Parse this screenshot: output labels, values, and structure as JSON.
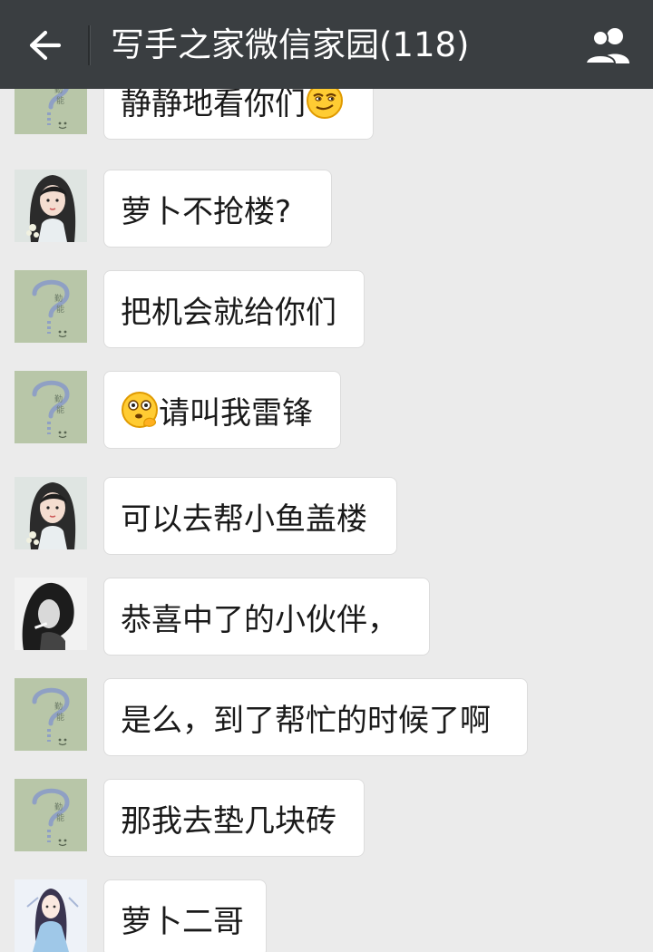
{
  "header": {
    "title": "写手之家微信家园(118)",
    "back_icon": "arrow-left-icon",
    "group_icon": "group-members-icon"
  },
  "colors": {
    "topbar": "#3a3e41",
    "background": "#ebebeb",
    "bubble": "#ffffff"
  },
  "messages": [
    {
      "avatar": "question-mark-avatar",
      "text": "静静地看你们",
      "emoji_after": "smirk-emoji"
    },
    {
      "avatar": "lady-portrait-avatar",
      "text": "萝卜不抢楼?"
    },
    {
      "avatar": "question-mark-avatar",
      "text": "把机会就给你们"
    },
    {
      "avatar": "question-mark-avatar",
      "text": "请叫我雷锋",
      "emoji_before": "thinking-emoji"
    },
    {
      "avatar": "lady-portrait-avatar",
      "text": "可以去帮小鱼盖楼"
    },
    {
      "avatar": "smoking-woman-avatar",
      "text": "恭喜中了的小伙伴，"
    },
    {
      "avatar": "question-mark-avatar",
      "text": "是么，到了帮忙的时候了啊"
    },
    {
      "avatar": "question-mark-avatar",
      "text": "那我去垫几块砖"
    },
    {
      "avatar": "anime-girl-avatar",
      "text": "萝卜二哥"
    }
  ]
}
